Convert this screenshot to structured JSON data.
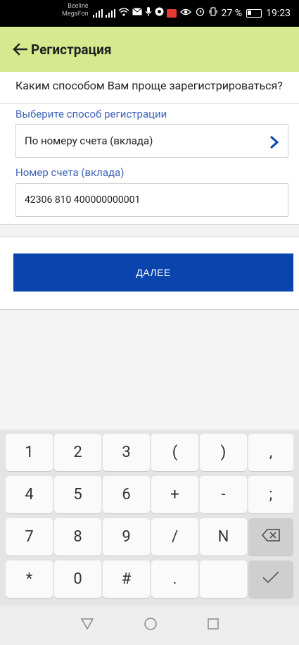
{
  "status_bar": {
    "carrier1": "Beeline",
    "carrier2": "MegaFon",
    "battery": "27 %",
    "time": "19:23"
  },
  "app_bar": {
    "title": "Регистрация",
    "back_icon": "arrow-left-icon"
  },
  "question": "Каким способом Вам проще зарегистрироваться?",
  "method": {
    "label": "Выберите способ регистрации",
    "value": "По номеру счета (вклада)"
  },
  "account": {
    "label": "Номер счета (вклада)",
    "value": "42306 810 400000000001"
  },
  "next_button": "ДАЛЕЕ",
  "keyboard": {
    "rows": [
      [
        "1",
        "2",
        "3",
        "(",
        ")",
        ","
      ],
      [
        "4",
        "5",
        "6",
        "+",
        "-",
        ";"
      ],
      [
        "7",
        "8",
        "9",
        "/",
        "N",
        ""
      ],
      [
        "*",
        "0",
        "#",
        ".",
        "",
        ""
      ]
    ],
    "backspace_icon": "backspace-icon",
    "done_icon": "checkmark-icon"
  },
  "colors": {
    "app_bar": "#d6e98f",
    "accent_label": "#3f64b5",
    "button": "#0a44ad"
  }
}
